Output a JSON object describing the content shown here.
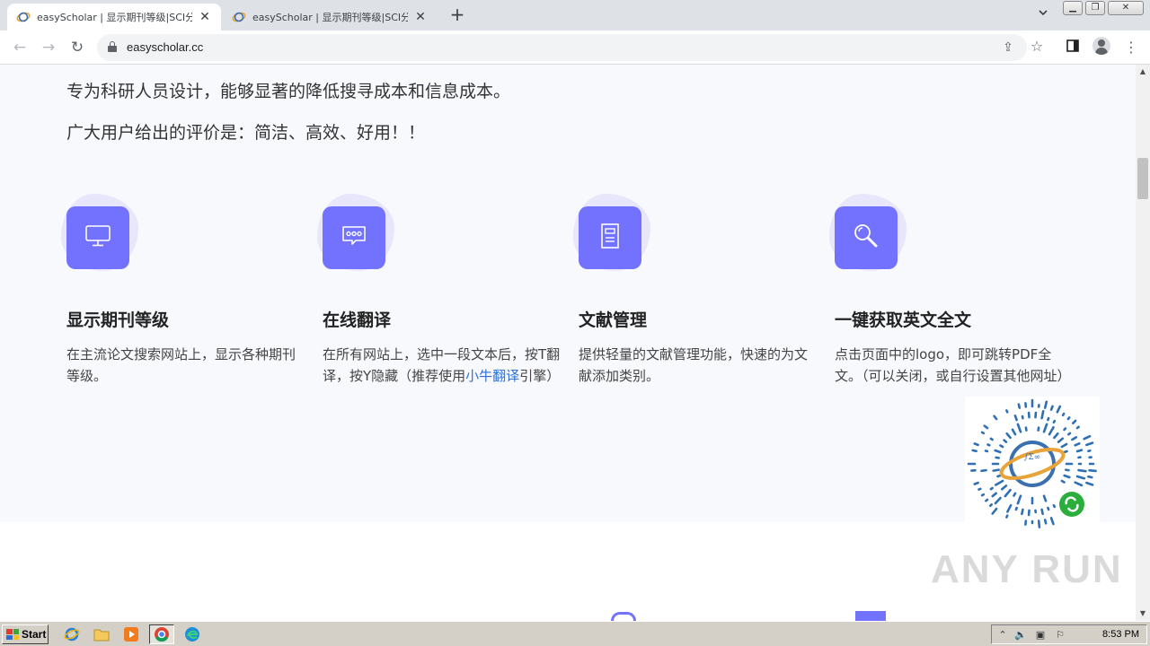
{
  "browser": {
    "tabs": [
      {
        "title": "easyScholar | 显示期刊等级|SCI分区",
        "active": true
      },
      {
        "title": "easyScholar | 显示期刊等级|SCI分区",
        "active": false
      }
    ],
    "new_tab_label": "+",
    "address": "easyscholar.cc"
  },
  "page": {
    "intro_lines": [
      "专为科研人员设计，能够显著的降低搜寻成本和信息成本。",
      "广大用户给出的评价是：简洁、高效、好用！！"
    ],
    "features": [
      {
        "icon": "monitor-icon",
        "title": "显示期刊等级",
        "desc": "在主流论文搜索网站上，显示各种期刊等级。"
      },
      {
        "icon": "chat-bubble-icon",
        "title": "在线翻译",
        "desc_before": "在所有网站上，选中一段文本后，按T翻译，按Y隐藏（推荐使用",
        "desc_link": "小牛翻译",
        "desc_after": "引擎）"
      },
      {
        "icon": "document-icon",
        "title": "文献管理",
        "desc": "提供轻量的文献管理功能，快速的为文献添加类别。"
      },
      {
        "icon": "magnifier-icon",
        "title": "一键获取英文全文",
        "desc": "点击页面中的logo，即可跳转PDF全文。（可以关闭，或自行设置其他网址）"
      }
    ],
    "accent_color": "#7272ff",
    "qr_caption": "∫Σ∞"
  },
  "watermark": "ANY RUN",
  "taskbar": {
    "start_label": "Start",
    "clock": "8:53 PM"
  }
}
